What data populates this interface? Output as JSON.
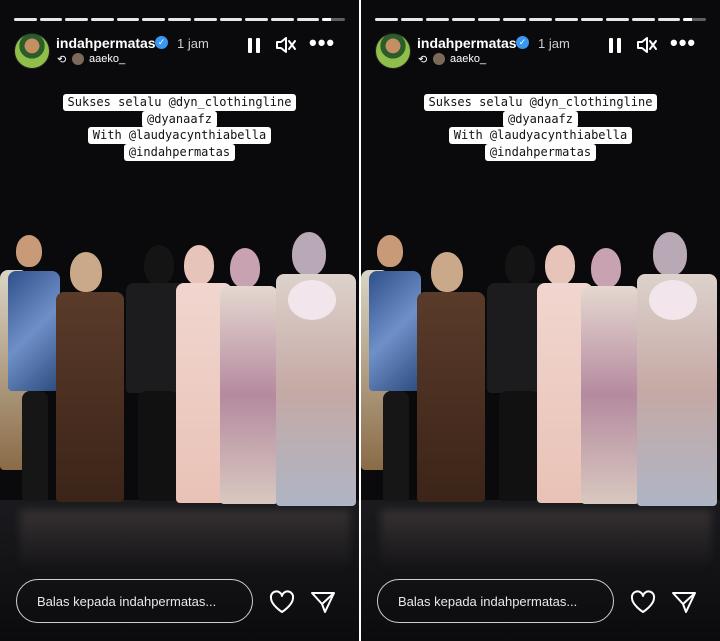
{
  "story": {
    "username": "indahpermatas",
    "verified_mark": "✓",
    "time": "1 jam",
    "repost_user": "aaeko_",
    "progress": [
      1,
      1,
      1,
      1,
      1,
      1,
      1,
      1,
      1,
      1,
      1,
      1,
      0.4
    ],
    "captions": [
      "Sukses selalu @dyn_clothingline",
      "@dyanaafz",
      "With @laudyacynthiabella",
      "@indahpermatas"
    ],
    "reply_placeholder": "Balas kepada indahpermatas...",
    "icons": {
      "pause": "pause-icon",
      "mute": "speaker-muted-icon",
      "more": "more-dots-icon",
      "like": "heart-icon",
      "share": "send-icon",
      "repost": "repost-icon"
    },
    "more_glyph": "•••",
    "repost_glyph": "⟲"
  },
  "colors": {
    "background": "#0a0a0c",
    "verified": "#3897f0",
    "text": "#ffffff"
  }
}
